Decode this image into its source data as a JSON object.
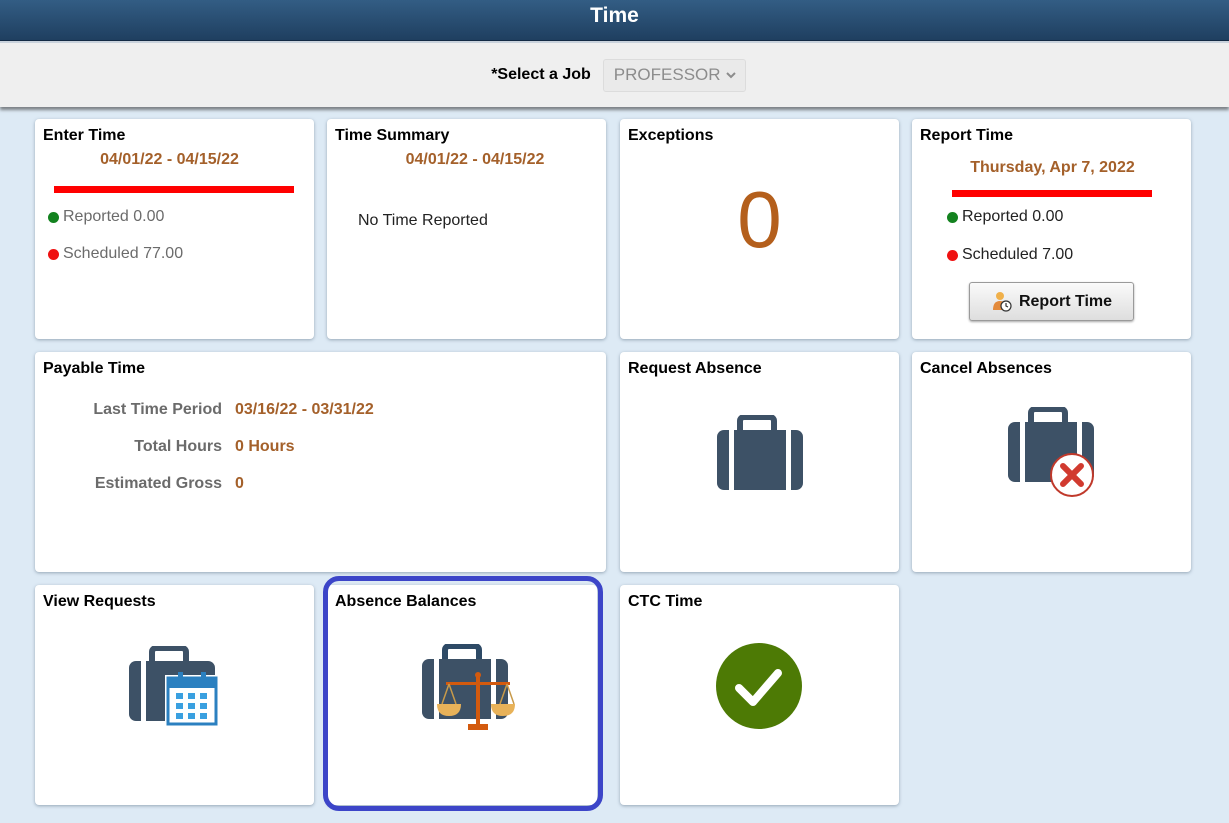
{
  "header": {
    "title": "Time"
  },
  "job_selector": {
    "label": "*Select a Job",
    "selected": "PROFESSOR",
    "chevron_icon": "chevron-down-icon"
  },
  "tiles": {
    "enter_time": {
      "title": "Enter Time",
      "period": "04/01/22 - 04/15/22",
      "reported": "Reported 0.00",
      "scheduled": "Scheduled 77.00",
      "colors": {
        "bar": "#ff0000",
        "reported_dot": "#13821f",
        "scheduled_dot": "#ef1111"
      }
    },
    "time_summary": {
      "title": "Time Summary",
      "period": "04/01/22 - 04/15/22",
      "message": "No Time Reported"
    },
    "exceptions": {
      "title": "Exceptions",
      "count": "0"
    },
    "report_time": {
      "title": "Report Time",
      "date": "Thursday, Apr 7, 2022",
      "reported": "Reported 0.00",
      "scheduled": "Scheduled 7.00",
      "button_label": "Report Time",
      "button_icon": "person-clock-icon"
    },
    "payable_time": {
      "title": "Payable Time",
      "rows": [
        {
          "label": "Last Time Period",
          "value": "03/16/22 - 03/31/22"
        },
        {
          "label": "Total Hours",
          "value": "0 Hours"
        },
        {
          "label": "Estimated Gross",
          "value": "0"
        }
      ]
    },
    "request_absence": {
      "title": "Request Absence",
      "icon": "briefcase-icon"
    },
    "cancel_absences": {
      "title": "Cancel Absences",
      "icon": "briefcase-cancel-icon"
    },
    "view_requests": {
      "title": "View Requests",
      "icon": "briefcase-calendar-icon"
    },
    "absence_balances": {
      "title": "Absence Balances",
      "icon": "briefcase-scales-icon",
      "focused": true
    },
    "ctc_time": {
      "title": "CTC Time",
      "icon": "green-check-icon"
    }
  },
  "colors": {
    "accent_brown": "#a4602a",
    "icon_navy": "#3d5166",
    "check_green": "#4d7a05",
    "focus_ring": "#3c45c8",
    "banner": "#2a4d72"
  }
}
